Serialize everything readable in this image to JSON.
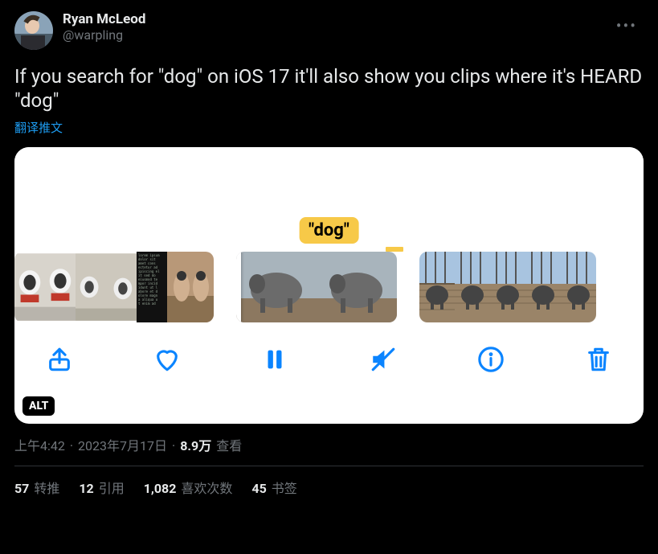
{
  "author": {
    "display_name": "Ryan McLeod",
    "handle": "@warpling"
  },
  "tweet_text": "If you search for \"dog\" on iOS 17 it'll also show you clips where it's HEARD \"dog\"",
  "translate_label": "翻译推文",
  "media": {
    "search_tag": "\"dog\"",
    "alt_badge": "ALT",
    "toolbar": {
      "share": "share",
      "like": "like",
      "pause": "pause",
      "mute": "mute",
      "info": "info",
      "delete": "delete"
    }
  },
  "meta": {
    "time": "上午4:42",
    "sep": "·",
    "date": "2023年7月17日",
    "views_count": "8.9万",
    "views_label": "查看"
  },
  "stats": {
    "retweets_count": "57",
    "retweets_label": "转推",
    "quotes_count": "12",
    "quotes_label": "引用",
    "likes_count": "1,082",
    "likes_label": "喜欢次数",
    "bookmarks_count": "45",
    "bookmarks_label": "书签"
  }
}
